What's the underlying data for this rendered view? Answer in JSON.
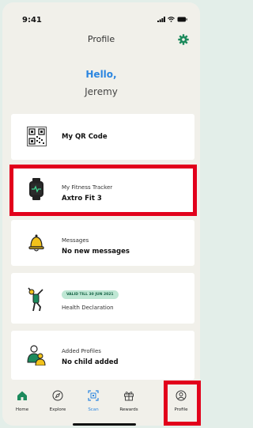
{
  "status_bar": {
    "time": "9:41"
  },
  "header": {
    "title": "Profile"
  },
  "greeting": {
    "hello": "Hello,",
    "name": "Jeremy"
  },
  "cards": {
    "qr": {
      "title": "My QR Code"
    },
    "tracker": {
      "title": "My Fitness Tracker",
      "value": "Axtro Fit 3"
    },
    "messages": {
      "title": "Messages",
      "value": "No new messages"
    },
    "health": {
      "badge": "VALID TILL 30 JUN 2021",
      "title": "Health Declaration"
    },
    "profiles": {
      "title": "Added Profiles",
      "value": "No child added"
    }
  },
  "nav": {
    "home": "Home",
    "explore": "Explore",
    "scan": "Scan",
    "rewards": "Rewards",
    "profile": "Profile"
  },
  "colors": {
    "accent_blue": "#2c86e0",
    "brand_green": "#1c8a5c",
    "highlight_red": "#e2001b",
    "icon_yellow": "#f2c21b"
  },
  "icons": [
    "signal-icon",
    "wifi-icon",
    "battery-icon",
    "gear-icon",
    "qr-code-icon",
    "smartwatch-icon",
    "bell-icon",
    "person-pose-icon",
    "family-icon",
    "home-icon",
    "compass-icon",
    "scan-icon",
    "gift-icon",
    "user-icon"
  ]
}
